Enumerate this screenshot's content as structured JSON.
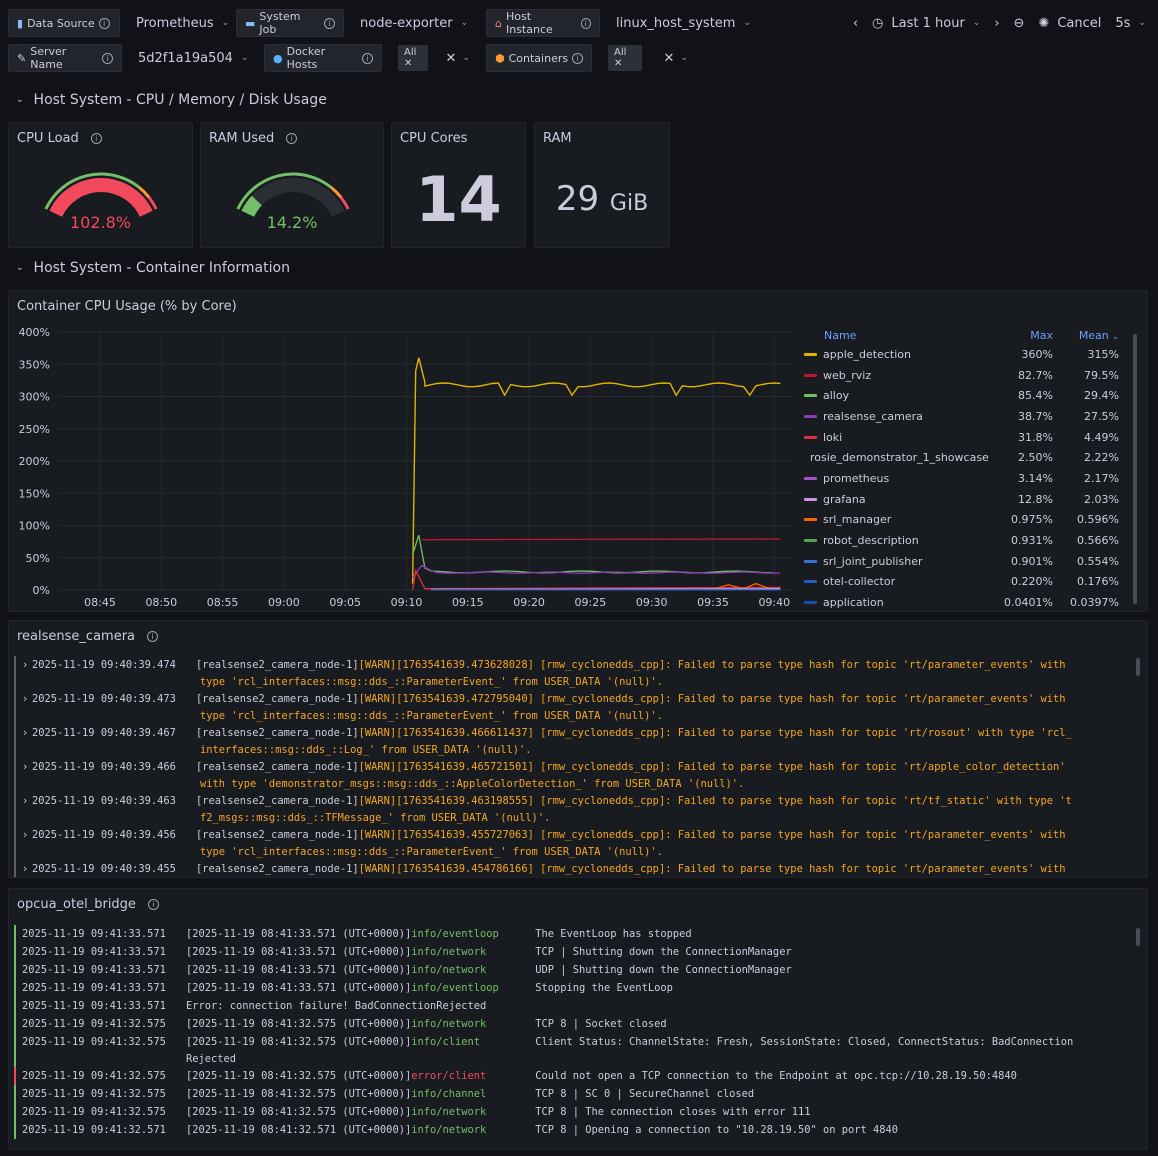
{
  "toolbar": {
    "vars_row1": [
      {
        "label": "Data Source",
        "icon": "chart-icon",
        "value": "Prometheus"
      },
      {
        "label": "System Job",
        "icon": "monitor-icon",
        "value": "node-exporter"
      },
      {
        "label": "Host Instance",
        "icon": "house-icon",
        "value": "linux_host_system"
      }
    ],
    "server_label": "Server Name",
    "server_value": "5d2f1a19a504",
    "docker_label": "Docker Hosts",
    "docker_chip": "All",
    "containers_label": "Containers",
    "containers_chip": "All",
    "time_range": "Last 1 hour",
    "cancel_label": "Cancel",
    "refresh": "5s"
  },
  "row1": {
    "title": "Host System - CPU / Memory / Disk Usage"
  },
  "row2": {
    "title": "Host System - Container Information"
  },
  "stats": {
    "cpu_load": {
      "title": "CPU Load",
      "value": "102.8%",
      "fraction": 1.0,
      "color": "#f2495c"
    },
    "ram_used": {
      "title": "RAM Used",
      "value": "14.2%",
      "fraction": 0.142,
      "color": "#73bf69"
    },
    "cpu_cores": {
      "title": "CPU Cores",
      "value": "14"
    },
    "ram": {
      "title": "RAM",
      "value": "29",
      "unit": "GiB"
    }
  },
  "chart_panel": {
    "title": "Container CPU Usage (% by Core)"
  },
  "chart_data": {
    "type": "line",
    "title": "Container CPU Usage (% by Core)",
    "x": [
      "08:45",
      "08:50",
      "08:55",
      "09:00",
      "09:05",
      "09:10",
      "09:15",
      "09:20",
      "09:25",
      "09:30",
      "09:35",
      "09:40"
    ],
    "ylim": [
      0,
      400
    ],
    "yticks": [
      "0%",
      "50%",
      "100%",
      "150%",
      "200%",
      "250%",
      "300%",
      "350%",
      "400%"
    ],
    "legend": {
      "name": "Name",
      "max": "Max",
      "mean": "Mean"
    },
    "series": [
      {
        "name": "apple_detection",
        "max": "360%",
        "mean": "315%",
        "color": "#e0b400"
      },
      {
        "name": "web_rviz",
        "max": "82.7%",
        "mean": "79.5%",
        "color": "#c4162a"
      },
      {
        "name": "alloy",
        "max": "85.4%",
        "mean": "29.4%",
        "color": "#73bf69"
      },
      {
        "name": "realsense_camera",
        "max": "38.7%",
        "mean": "27.5%",
        "color": "#8f3bb8"
      },
      {
        "name": "loki",
        "max": "31.8%",
        "mean": "4.49%",
        "color": "#e02f44"
      },
      {
        "name": "rosie_demonstrator_1_showcase",
        "max": "2.50%",
        "mean": "2.22%",
        "color": "#cca300"
      },
      {
        "name": "prometheus",
        "max": "3.14%",
        "mean": "2.17%",
        "color": "#a352cc"
      },
      {
        "name": "grafana",
        "max": "12.8%",
        "mean": "2.03%",
        "color": "#ca95e5"
      },
      {
        "name": "srl_manager",
        "max": "0.975%",
        "mean": "0.596%",
        "color": "#fa6400"
      },
      {
        "name": "robot_description",
        "max": "0.931%",
        "mean": "0.566%",
        "color": "#56a64b"
      },
      {
        "name": "srl_joint_publisher",
        "max": "0.901%",
        "mean": "0.554%",
        "color": "#3274d9"
      },
      {
        "name": "otel-collector",
        "max": "0.220%",
        "mean": "0.176%",
        "color": "#1f60c4"
      },
      {
        "name": "application",
        "max": "0.0401%",
        "mean": "0.0397%",
        "color": "#1250b0"
      }
    ]
  },
  "log1": {
    "title": "realsense_camera",
    "lines": [
      {
        "ts": "2025-11-19 09:40:39.474",
        "pre": "[realsense2_camera_node-1] ",
        "lvl": "[WARN]",
        "l1": " [1763541639.473628028] [rmw_cyclonedds_cpp]: Failed to parse type hash for topic 'rt/parameter_events' with",
        "l2": "type 'rcl_interfaces::msg::dds_::ParameterEvent_' from USER_DATA '(null)'."
      },
      {
        "ts": "2025-11-19 09:40:39.473",
        "pre": "[realsense2_camera_node-1] ",
        "lvl": "[WARN]",
        "l1": " [1763541639.472795040] [rmw_cyclonedds_cpp]: Failed to parse type hash for topic 'rt/parameter_events' with",
        "l2": "type 'rcl_interfaces::msg::dds_::ParameterEvent_' from USER_DATA '(null)'."
      },
      {
        "ts": "2025-11-19 09:40:39.467",
        "pre": "[realsense2_camera_node-1] ",
        "lvl": "[WARN]",
        "l1": " [1763541639.466611437] [rmw_cyclonedds_cpp]: Failed to parse type hash for topic 'rt/rosout' with type 'rcl_",
        "l2": "interfaces::msg::dds_::Log_' from USER_DATA '(null)'."
      },
      {
        "ts": "2025-11-19 09:40:39.466",
        "pre": "[realsense2_camera_node-1] ",
        "lvl": "[WARN]",
        "l1": " [1763541639.465721501] [rmw_cyclonedds_cpp]: Failed to parse type hash for topic 'rt/apple_color_detection'",
        "l2": "with type 'demonstrator_msgs::msg::dds_::AppleColorDetection_' from USER_DATA '(null)'."
      },
      {
        "ts": "2025-11-19 09:40:39.463",
        "pre": "[realsense2_camera_node-1] ",
        "lvl": "[WARN]",
        "l1": " [1763541639.463198555] [rmw_cyclonedds_cpp]: Failed to parse type hash for topic 'rt/tf_static' with type 't",
        "l2": "f2_msgs::msg::dds_::TFMessage_' from USER_DATA '(null)'."
      },
      {
        "ts": "2025-11-19 09:40:39.456",
        "pre": "[realsense2_camera_node-1] ",
        "lvl": "[WARN]",
        "l1": " [1763541639.455727063] [rmw_cyclonedds_cpp]: Failed to parse type hash for topic 'rt/parameter_events' with",
        "l2": "type 'rcl_interfaces::msg::dds_::ParameterEvent_' from USER_DATA '(null)'."
      },
      {
        "ts": "2025-11-19 09:40:39.455",
        "pre": "[realsense2_camera_node-1] ",
        "lvl": "[WARN]",
        "l1": " [1763541639.454786166] [rmw_cyclonedds_cpp]: Failed to parse type hash for topic 'rt/parameter_events' with",
        "l2": ""
      }
    ]
  },
  "log2": {
    "title": "opcua_otel_bridge",
    "lines": [
      {
        "ts": "2025-11-19 09:41:33.571",
        "pre": "[2025-11-19 08:41:33.571 (UTC+0000)] ",
        "lvl": "info/eventloop",
        "msg": "The EventLoop has stopped",
        "cont": "",
        "color": "#73bf69"
      },
      {
        "ts": "2025-11-19 09:41:33.571",
        "pre": "[2025-11-19 08:41:33.571 (UTC+0000)] ",
        "lvl": "info/network",
        "msg": "TCP     | Shutting down the ConnectionManager",
        "cont": "",
        "color": "#73bf69"
      },
      {
        "ts": "2025-11-19 09:41:33.571",
        "pre": "[2025-11-19 08:41:33.571 (UTC+0000)] ",
        "lvl": "info/network",
        "msg": "UDP     | Shutting down the ConnectionManager",
        "cont": "",
        "color": "#73bf69"
      },
      {
        "ts": "2025-11-19 09:41:33.571",
        "pre": "[2025-11-19 08:41:33.571 (UTC+0000)] ",
        "lvl": "info/eventloop",
        "msg": "Stopping the EventLoop",
        "cont": "",
        "color": "#73bf69"
      },
      {
        "ts": "2025-11-19 09:41:33.571",
        "pre": "Error: connection failure! BadConnectionRejected",
        "lvl": "",
        "msg": "",
        "cont": "",
        "color": "#73bf69"
      },
      {
        "ts": "2025-11-19 09:41:32.575",
        "pre": "[2025-11-19 08:41:32.575 (UTC+0000)] ",
        "lvl": "info/network",
        "msg": "TCP 8   | Socket closed",
        "cont": "",
        "color": "#73bf69"
      },
      {
        "ts": "2025-11-19 09:41:32.575",
        "pre": "[2025-11-19 08:41:32.575 (UTC+0000)] ",
        "lvl": "info/client",
        "msg": "Client Status: ChannelState: Fresh, SessionState: Closed, ConnectStatus: BadConnection",
        "cont": "Rejected",
        "color": "#73bf69"
      },
      {
        "ts": "2025-11-19 09:41:32.575",
        "pre": "[2025-11-19 08:41:32.575 (UTC+0000)] ",
        "lvl": "error/client",
        "msg": "Could not open a TCP connection to the Endpoint at opc.tcp://10.28.19.50:4840",
        "cont": "",
        "color": "#f2495c"
      },
      {
        "ts": "2025-11-19 09:41:32.575",
        "pre": "[2025-11-19 08:41:32.575 (UTC+0000)] ",
        "lvl": "info/channel",
        "msg": "TCP 8   | SC 0   | SecureChannel closed",
        "cont": "",
        "color": "#73bf69"
      },
      {
        "ts": "2025-11-19 09:41:32.575",
        "pre": "[2025-11-19 08:41:32.575 (UTC+0000)] ",
        "lvl": "info/network",
        "msg": "TCP 8   | The connection closes with error 111",
        "cont": "",
        "color": "#73bf69"
      },
      {
        "ts": "2025-11-19 09:41:32.571",
        "pre": "[2025-11-19 08:41:32.571 (UTC+0000)] ",
        "lvl": "info/network",
        "msg": "TCP 8   | Opening a connection to \"10.28.19.50\" on port 4840",
        "cont": "",
        "color": "#73bf69"
      }
    ]
  }
}
